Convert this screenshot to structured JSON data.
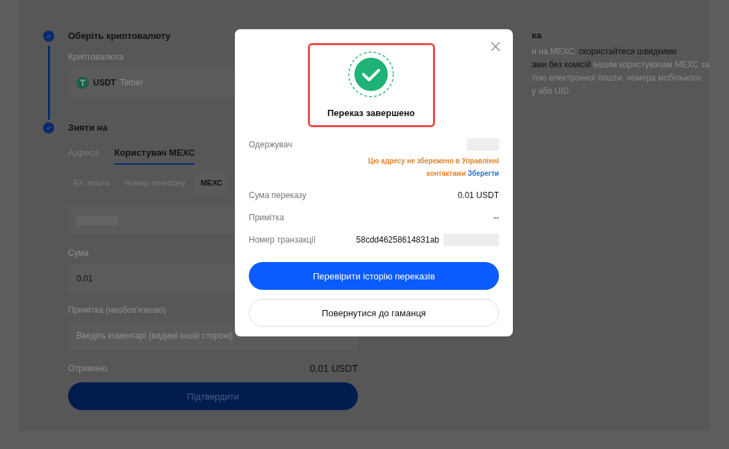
{
  "steps": [
    {
      "title": "Оберіть криптовалюту",
      "completed": true
    },
    {
      "title": "Зняти на",
      "completed": true
    }
  ],
  "crypto": {
    "label": "Криптовалюта",
    "symbol": "USDT",
    "name": "Tether"
  },
  "withdraw_tabs": [
    {
      "label": "Адреса",
      "selected": false
    },
    {
      "label": "Користувач МЕХС",
      "selected": true
    }
  ],
  "recipient_types": [
    {
      "label": "Ел. пошта",
      "selected": false
    },
    {
      "label": "Номер телефону",
      "selected": false
    },
    {
      "label": "МЕХС",
      "selected": true
    }
  ],
  "amount": {
    "label": "Сума",
    "value": "0.01"
  },
  "note": {
    "label": "Примітка (необов'язково)",
    "placeholder": "Введіть коментарі (видимі іншій стороні)"
  },
  "received": {
    "label": "Отримано",
    "value": "0,01 USDT"
  },
  "confirm_button": "Підтвердити",
  "info": {
    "heading": "ка",
    "lines": [
      "и на МЕХС: **скористайтеся швидкими**",
      "**ами без комісій** іншим користувачам МЕХС за",
      "тою електронної пошти, номера мобільного",
      "у або UID."
    ]
  },
  "dialog": {
    "title": "Переказ завершено",
    "recipient_label": "Одержувач",
    "warning": "Цю адресу не збережено в Управлінні контактами",
    "save_link": "Зберегти",
    "rows": [
      {
        "label": "Сума переказу",
        "value": "0.01 USDT"
      },
      {
        "label": "Примітка",
        "value": "--"
      },
      {
        "label": "Номер транзакції",
        "value": "58cdd46258614831ab"
      }
    ],
    "primary_button": "Перевірити історію переказів",
    "secondary_button": "Повернутися до гаманця"
  }
}
